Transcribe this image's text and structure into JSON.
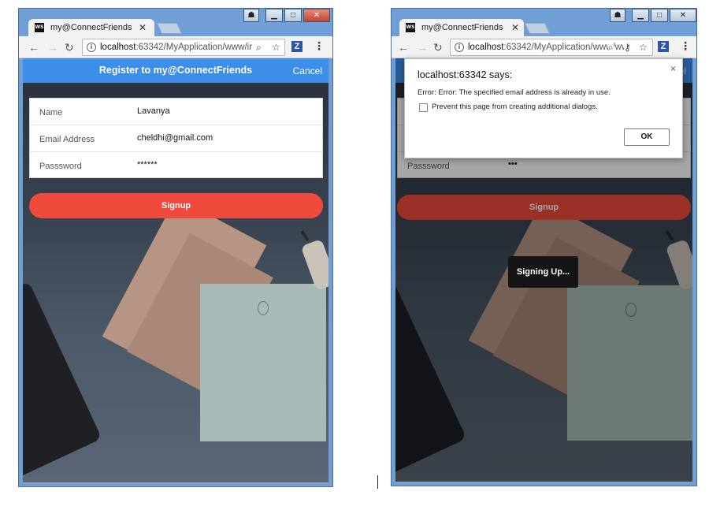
{
  "left": {
    "tab_title": "my@ConnectFriends",
    "tab_icon": "WS",
    "address_host": "localhost",
    "address_rest": ":63342/MyApplication/www/ir",
    "app_title": "Register to my@ConnectFriends",
    "cancel_label": "Cancel",
    "fields": [
      {
        "label": "Name",
        "value": "Lavanya"
      },
      {
        "label": "Email Address",
        "value": "cheldhi@gmail.com"
      },
      {
        "label": "Passsword",
        "value": "******"
      }
    ],
    "signup_label": "Signup"
  },
  "right": {
    "tab_title": "my@ConnectFriends",
    "tab_icon": "WS",
    "address_host": "localhost",
    "address_rest": ":63342/MyApplication/www/ww",
    "cancel_partial": "el",
    "password_label": "Passsword",
    "password_value": "•••",
    "signup_label": "Signup",
    "toast": "Signing Up...",
    "dialog": {
      "title": "localhost:63342 says:",
      "message": "Error: Error: The specified email address is already in use.",
      "checkbox_label": "Prevent this page from creating additional dialogs.",
      "ok_label": "OK",
      "close_glyph": "×"
    }
  },
  "colors": {
    "app_bar": "#3d8ee8",
    "signup": "#ef4a3c",
    "window_frame": "#6f9fd4"
  }
}
